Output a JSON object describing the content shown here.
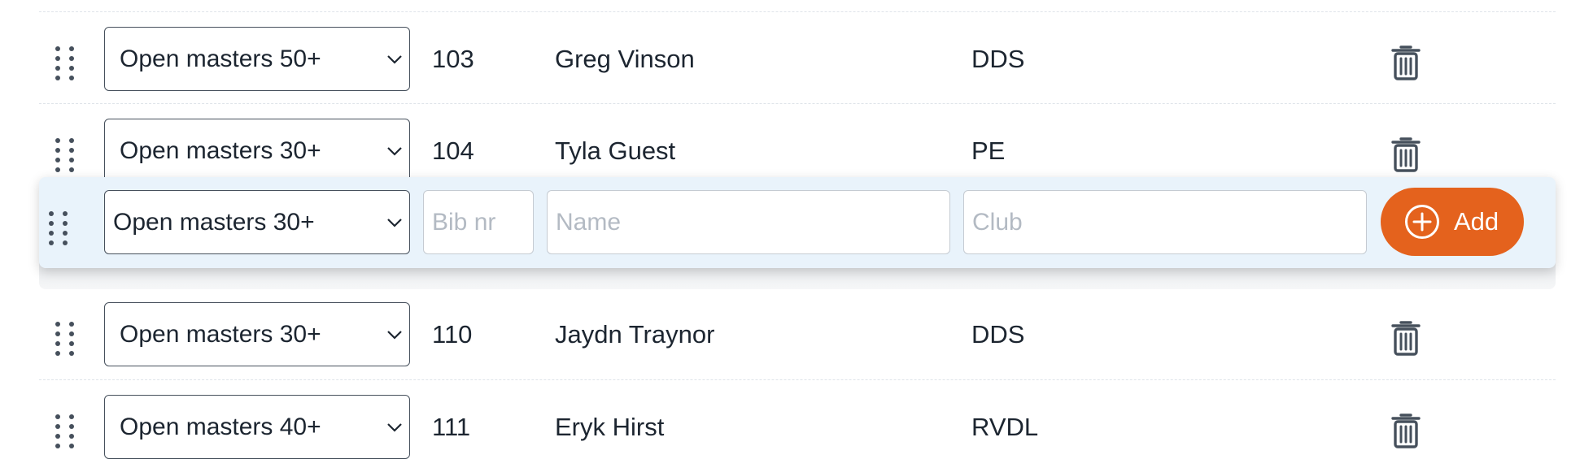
{
  "rows": [
    {
      "category": "Open masters 50+",
      "bib": "103",
      "name": "Greg Vinson",
      "club": "DDS"
    },
    {
      "category": "Open masters 30+",
      "bib": "104",
      "name": "Tyla Guest",
      "club": "PE"
    },
    {
      "category": "Open masters 30+",
      "bib": "110",
      "name": "Jaydn Traynor",
      "club": "DDS"
    },
    {
      "category": "Open masters 40+",
      "bib": "111",
      "name": "Eryk Hirst",
      "club": "RVDL"
    }
  ],
  "add_row": {
    "category": "Open masters 30+",
    "bib_placeholder": "Bib nr",
    "name_placeholder": "Name",
    "club_placeholder": "Club",
    "add_label": "Add"
  },
  "colors": {
    "accent": "#e4621d",
    "add_bar_bg": "#e9f3fb",
    "text": "#1c2530",
    "icon": "#46505c"
  },
  "icons": {
    "drag": "drag-handle-icon",
    "chevron": "chevron-down-icon",
    "delete": "trash-icon",
    "add": "plus-circle-icon"
  }
}
